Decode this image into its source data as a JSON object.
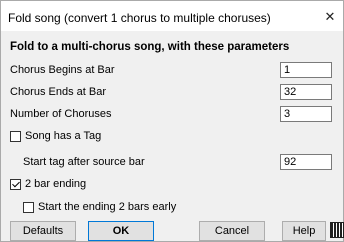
{
  "window": {
    "title": "Fold song (convert 1 chorus to multiple choruses)",
    "close_glyph": "✕"
  },
  "heading": "Fold to a multi-chorus song, with these parameters",
  "fields": {
    "chorus_begins": {
      "label": "Chorus Begins at Bar",
      "value": "1"
    },
    "chorus_ends": {
      "label": "Chorus Ends at Bar",
      "value": "32"
    },
    "num_choruses": {
      "label": "Number of Choruses",
      "value": "3"
    },
    "start_tag": {
      "label": "Start tag after source bar",
      "value": "92"
    }
  },
  "checkboxes": {
    "song_has_tag": {
      "label": "Song has a Tag",
      "checked": false
    },
    "two_bar_ending": {
      "label": "2 bar ending",
      "checked": true
    },
    "start_ending_early": {
      "label": "Start the ending 2 bars early",
      "checked": false
    }
  },
  "buttons": {
    "defaults": "Defaults",
    "ok": "OK",
    "cancel": "Cancel",
    "help": "Help"
  },
  "icons": {
    "grid": "grid-icon"
  }
}
